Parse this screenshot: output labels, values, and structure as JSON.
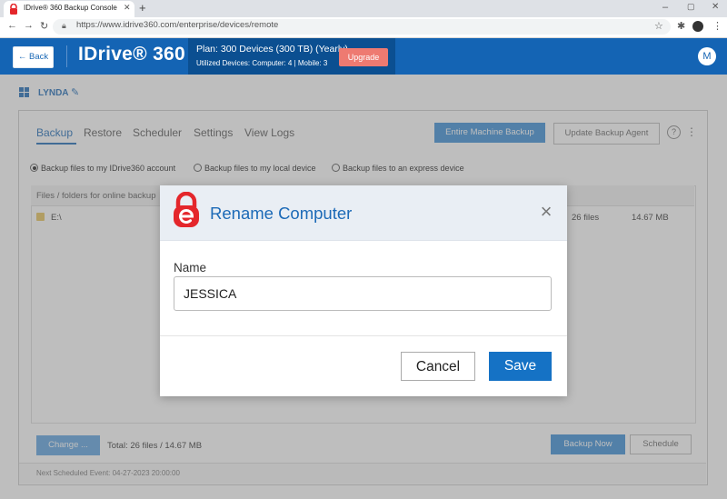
{
  "browser": {
    "tab_title": "IDrive® 360 Backup Console for",
    "new_tab": "+",
    "url": "https://www.idrive360.com/enterprise/devices/remote",
    "window_controls": [
      "–",
      "▢",
      "✕"
    ]
  },
  "header": {
    "back_label": "← Back",
    "logo_text": "IDrive® 360",
    "plan_line": "Plan: 300 Devices (300 TB) (Yearly)",
    "utilized_line": "Utilized Devices: Computer: 4 |  Mobile: 3",
    "upgrade_label": "Upgrade",
    "avatar_initial": "M"
  },
  "computer": {
    "name": "LYNDA"
  },
  "main": {
    "tabs": [
      {
        "label": "Backup"
      },
      {
        "label": "Restore"
      },
      {
        "label": "Scheduler"
      },
      {
        "label": "Settings"
      },
      {
        "label": "View Logs"
      }
    ],
    "entire_machine_backup_label": "Entire Machine Backup",
    "update_agent_label": "Update Backup Agent",
    "help_icon": "?",
    "more_icon": "⋮",
    "radio_options": [
      {
        "label": "Backup files to my IDrive360 account",
        "selected": true
      },
      {
        "label": "Backup files to my local device",
        "selected": false
      },
      {
        "label": "Backup files to an express device",
        "selected": false
      }
    ],
    "list_header": "Files / folders for online backup",
    "rows": [
      {
        "name": "E:\\",
        "count": "26 files",
        "size": "14.67 MB"
      }
    ],
    "change_label": "Change ...",
    "total_label": "Total: 26 files / 14.67 MB",
    "backup_now_label": "Backup Now",
    "schedule_label": "Schedule",
    "next_event": "Next Scheduled Event: 04-27-2023 20:00:00"
  },
  "modal": {
    "title": "Rename Computer",
    "close_icon": "×",
    "field_label": "Name",
    "field_value": "JESSICA",
    "cancel_label": "Cancel",
    "save_label": "Save"
  },
  "colors": {
    "brand_blue": "#1464b4",
    "upgrade": "#ee7a71",
    "save": "#1572c5",
    "logo_red": "#e4262b"
  }
}
